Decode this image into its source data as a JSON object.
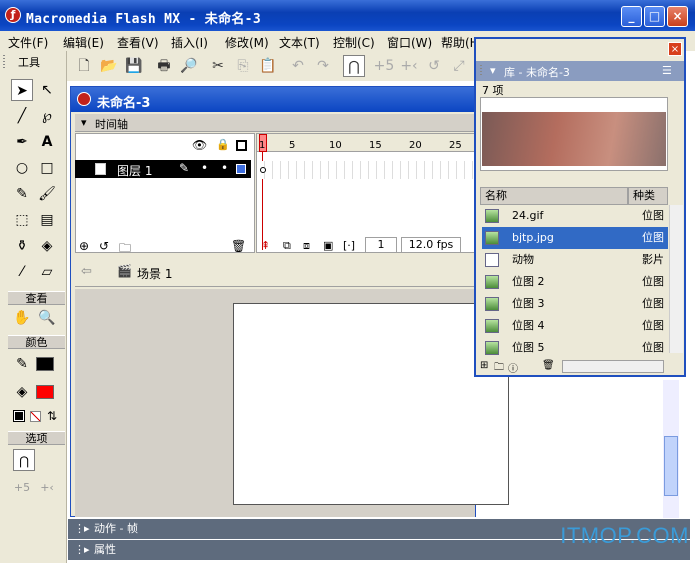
{
  "window": {
    "title": "Macromedia Flash MX - 未命名-3",
    "app_icon": "ƒ",
    "buttons": [
      "_",
      "□",
      "×"
    ]
  },
  "menu": [
    "文件(F)",
    "编辑(E)",
    "查看(V)",
    "插入(I)",
    "修改(M)",
    "文本(T)",
    "控制(C)",
    "窗口(W)",
    "帮助(H)"
  ],
  "tools": {
    "header": "工具",
    "view_header": "查看",
    "color_header": "颜色",
    "options_header": "选项"
  },
  "document": {
    "title": "未命名-3",
    "timeline_label": "时间轴",
    "layer_name": "图层 1",
    "frame_numbers": [
      "1",
      "5",
      "10",
      "15",
      "20",
      "25"
    ],
    "current_frame": "1",
    "fps": "12.0 fps",
    "scene": "场景 1"
  },
  "library": {
    "title": "库 - 未命名-3",
    "count": "7 项",
    "col_name": "名称",
    "col_kind": "种类",
    "items": [
      {
        "name": "24.gif",
        "kind": "位图"
      },
      {
        "name": "bjtp.jpg",
        "kind": "位图"
      },
      {
        "name": "动物",
        "kind": "影片"
      },
      {
        "name": "位图 2",
        "kind": "位图"
      },
      {
        "name": "位图 3",
        "kind": "位图"
      },
      {
        "name": "位图 4",
        "kind": "位图"
      },
      {
        "name": "位图 5",
        "kind": "位图"
      }
    ]
  },
  "panels": {
    "actions": "动作 - 帧",
    "properties": "属性"
  },
  "watermark": "ITMOP.COM",
  "colors": {
    "stroke": "#000000",
    "fill": "#ff0000",
    "title_blue": "#0b45c2"
  }
}
